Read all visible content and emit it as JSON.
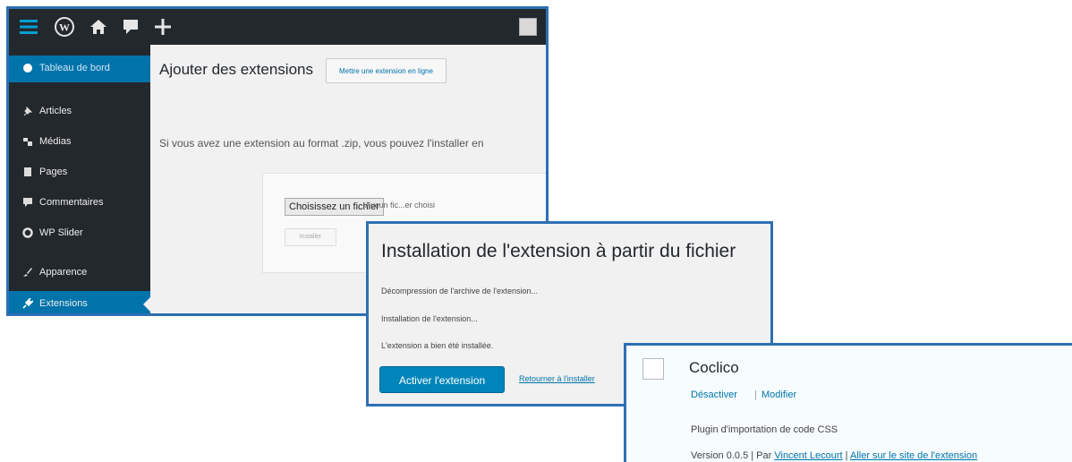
{
  "admin": {
    "page_title": "Ajouter des extensions",
    "upload_button": "Mettre une extension en ligne",
    "description": "Si vous avez une extension au format .zip, vous pouvez l'installer en",
    "choose_file": "Choisissez un fichier",
    "no_file": "Aucun fic...er choisi",
    "install_button": "Installer",
    "sidebar": [
      {
        "label": "Tableau de bord",
        "icon": "dashboard-icon"
      },
      {
        "label": "Articles",
        "icon": "pin-icon"
      },
      {
        "label": "Médias",
        "icon": "media-icon"
      },
      {
        "label": "Pages",
        "icon": "page-icon"
      },
      {
        "label": "Commentaires",
        "icon": "comment-icon"
      },
      {
        "label": "WP Slider",
        "icon": "gear-icon"
      },
      {
        "label": "Apparence",
        "icon": "brush-icon"
      },
      {
        "label": "Extensions",
        "icon": "plugin-icon"
      }
    ]
  },
  "install": {
    "title": "Installation de l'extension à partir du fichier",
    "steps": [
      "Décompression de l'archive de l'extension...",
      "Installation de l'extension...",
      "L'extension a bien été installée."
    ],
    "activate_button": "Activer l'extension",
    "return_link": "Retourner à l'installer"
  },
  "plugin": {
    "name": "Coclico",
    "deactivate": "Désactiver",
    "separator": "|",
    "edit": "Modifier",
    "description": "Plugin d'importation de code CSS",
    "version_text": "Version 0.0.5 | Par ",
    "author": "Vincent Lecourt",
    "sep2": " | ",
    "site_link": "Aller sur le site de l'extension"
  },
  "colors": {
    "adminbar": "#23282d",
    "accent": "#0073aa",
    "button_primary": "#0085ba",
    "frame": "#2e6fb5"
  }
}
